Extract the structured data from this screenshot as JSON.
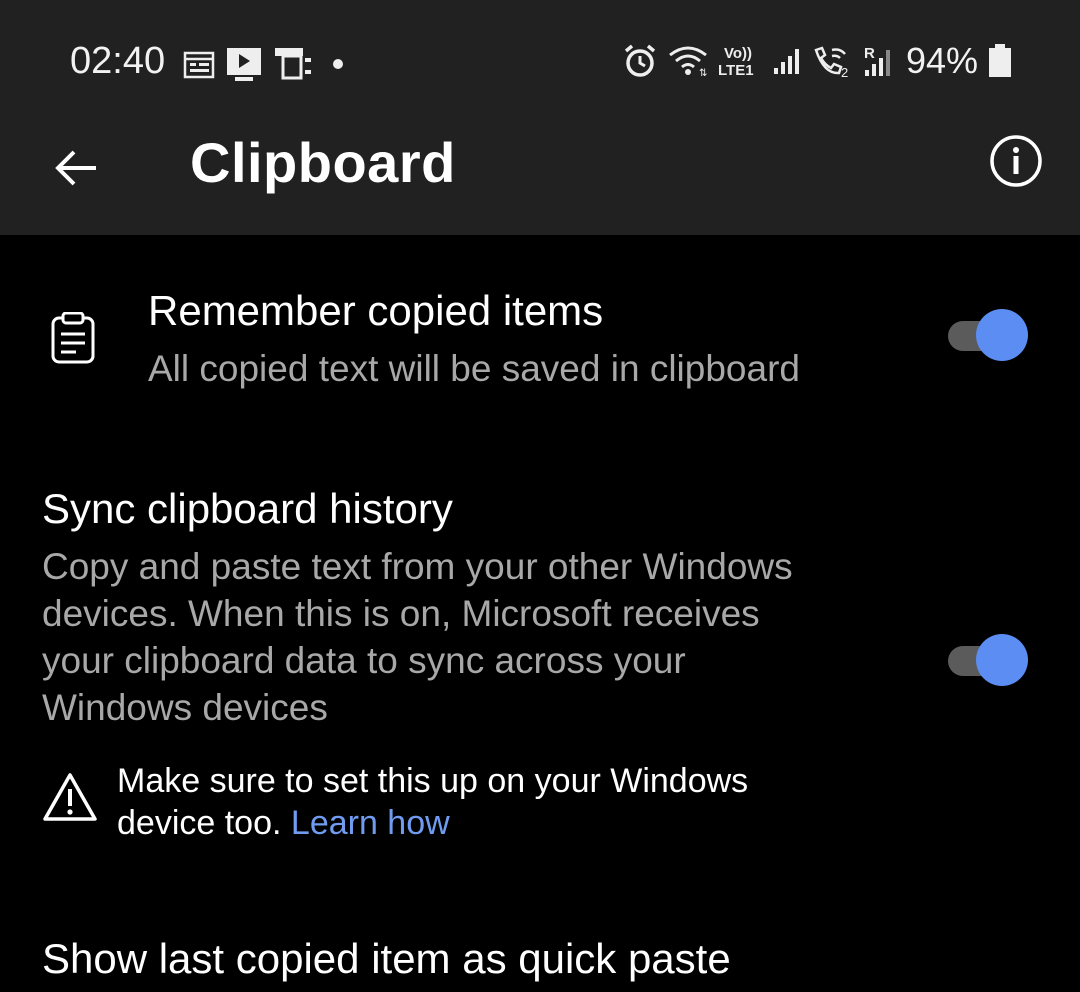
{
  "status_bar": {
    "time": "02:40",
    "left_icons": [
      "calendar-icon",
      "video-icon",
      "cast-icon",
      "dot-icon"
    ],
    "right_icons": [
      "alarm-icon",
      "wifi-icon",
      "volte-icon",
      "signal-icon",
      "wifi-calling-icon",
      "roaming-signal-icon"
    ],
    "volte_label": "Vo)) LTE1",
    "battery_percent": "94%"
  },
  "app_bar": {
    "title": "Clipboard",
    "back_icon": "arrow-left-icon",
    "info_icon": "info-icon"
  },
  "settings": {
    "remember": {
      "title": "Remember copied items",
      "subtitle": "All copied text will be saved in clipboard",
      "enabled": true,
      "icon": "clipboard-icon"
    },
    "sync": {
      "title": "Sync clipboard history",
      "subtitle_lines": [
        "Copy and paste text from your other Windows",
        "devices. When this is on, Microsoft receives",
        "your clipboard data to sync across your",
        "Windows devices"
      ],
      "enabled": true
    },
    "warning": {
      "line1": "Make sure to set this up on your Windows",
      "line2_prefix": "device too.",
      "link": "Learn how",
      "icon": "warning-icon"
    },
    "quick_paste": {
      "title": "Show last copied item as quick paste"
    }
  },
  "colors": {
    "accent": "#5b8df2",
    "link": "#6f9cf0",
    "bar_bg": "#212121",
    "bg": "#000000"
  }
}
